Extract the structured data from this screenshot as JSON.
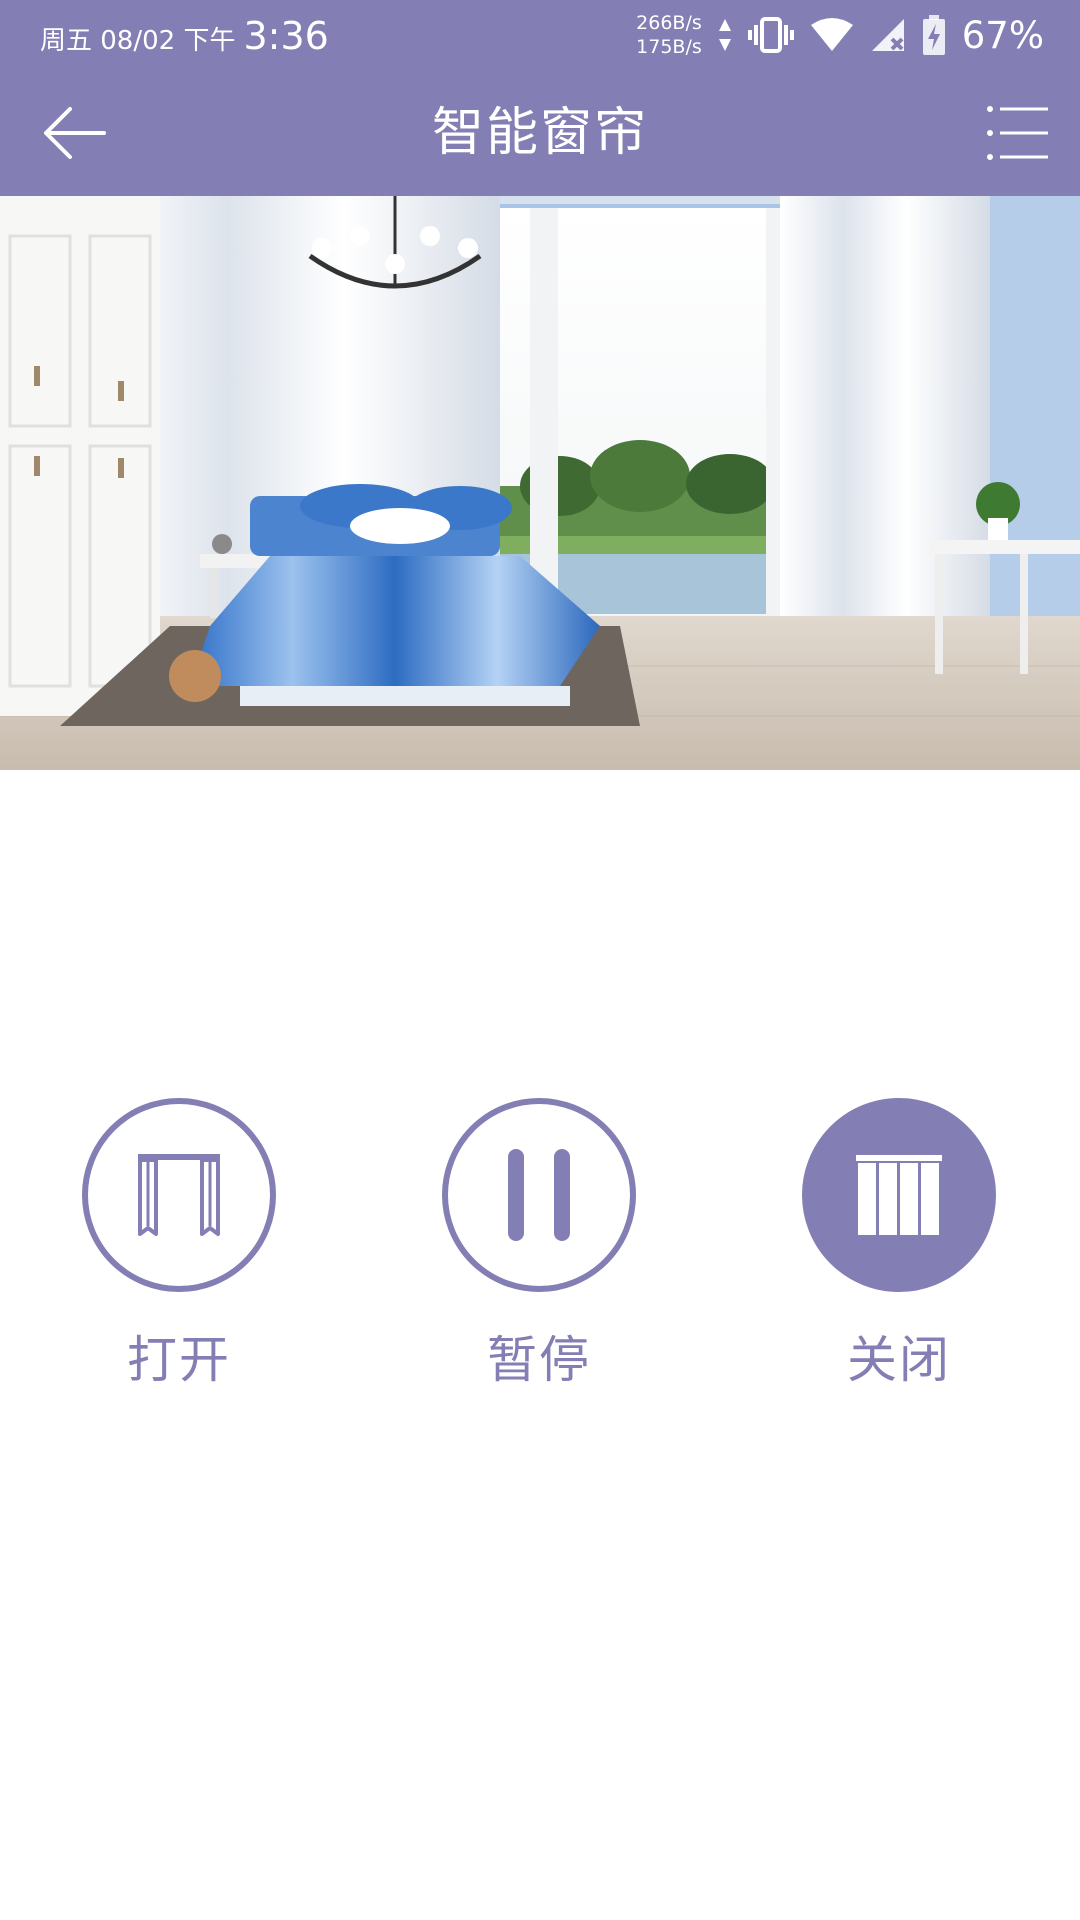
{
  "status_bar": {
    "date": "周五 08/02 下午",
    "time": "3:36",
    "net_up": "266B/s",
    "net_down": "175B/s",
    "battery": "67%",
    "icons": [
      "vibrate-icon",
      "wifi-icon",
      "no-signal-icon",
      "battery-charging-icon"
    ]
  },
  "app_bar": {
    "title": "智能窗帘",
    "back_icon": "back-arrow-icon",
    "menu_icon": "list-menu-icon"
  },
  "hero": {
    "image": "bedroom-with-curtains-illustration"
  },
  "controls": [
    {
      "label": "打开",
      "icon": "curtain-open-icon",
      "active": false
    },
    {
      "label": "暂停",
      "icon": "pause-icon",
      "active": false
    },
    {
      "label": "关闭",
      "icon": "curtain-closed-icon",
      "active": true
    }
  ],
  "colors": {
    "primary": "#837eb3",
    "background": "#ffffff"
  }
}
